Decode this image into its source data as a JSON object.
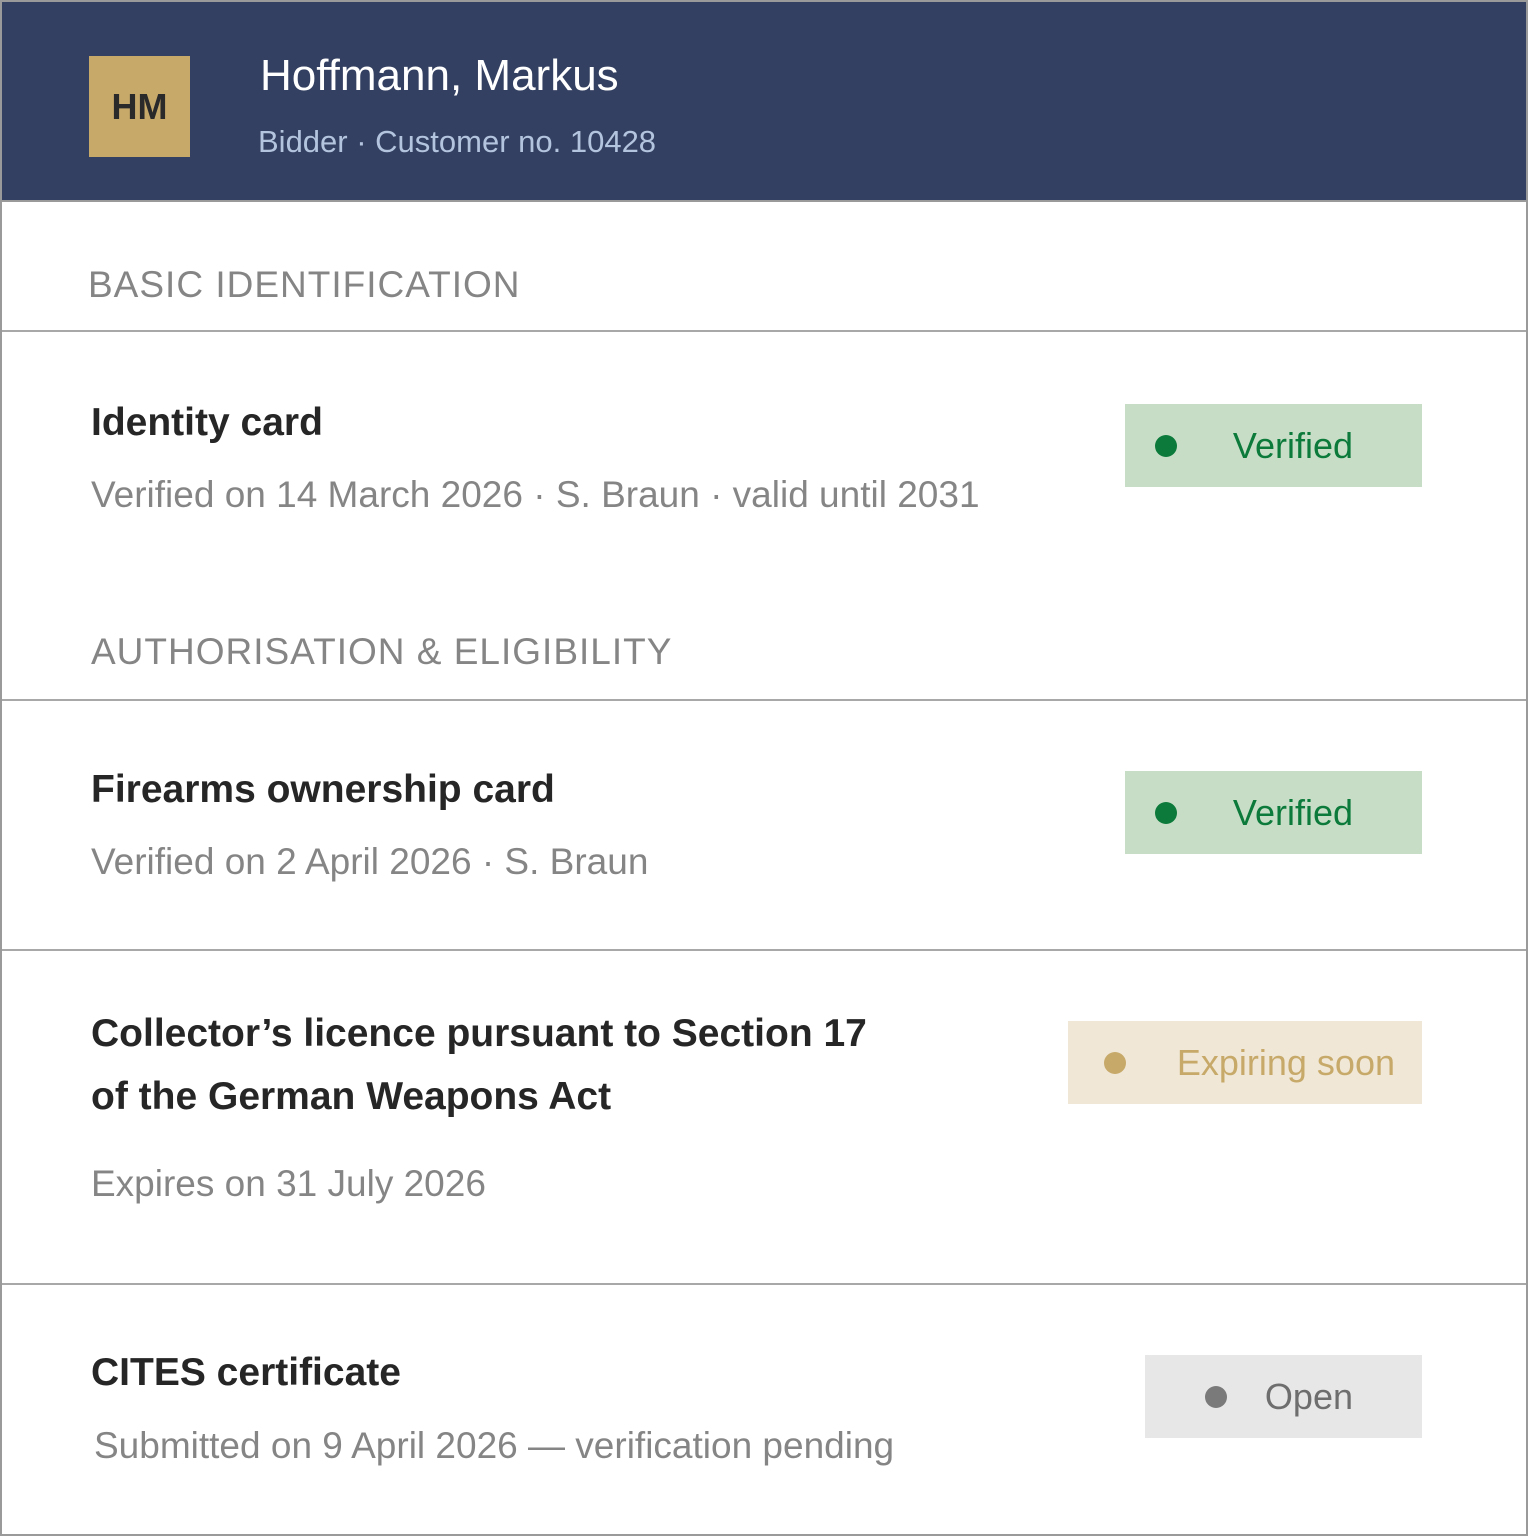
{
  "profile": {
    "initials": "HM",
    "name": "Hoffmann, Markus",
    "subtitle": "Bidder · Customer no. 10428"
  },
  "sections": {
    "basic": {
      "label": "BASIC IDENTIFICATION"
    },
    "authorisation": {
      "label": "AUTHORISATION & ELIGIBILITY"
    }
  },
  "documents": {
    "identity_card": {
      "title": "Identity card",
      "meta": "Verified on 14 March 2026 · S. Braun · valid until 2031",
      "status": "Verified"
    },
    "firearms_card": {
      "title": "Firearms ownership card",
      "meta": "Verified on 2 April 2026 · S. Braun",
      "status": "Verified"
    },
    "collector_licence": {
      "title_line1": "Collector’s licence pursuant to Section 17",
      "title_line2": "of the German Weapons Act",
      "meta": "Expires on 31 July 2026",
      "status": "Expiring soon"
    },
    "cites_certificate": {
      "title": "CITES certificate",
      "meta": "Submitted on 9 April 2026 — verification pending",
      "status": "Open"
    }
  },
  "colors": {
    "header_background": "#344061",
    "avatar_gold": "#c7a96a",
    "verified_green": "#0c7a3a",
    "verified_background": "#c8ddc6",
    "expiring_gold": "#c7a96a",
    "expiring_background": "#f0e7d6",
    "open_grey": "#7a7a7a",
    "open_background": "#e7e7e7"
  }
}
